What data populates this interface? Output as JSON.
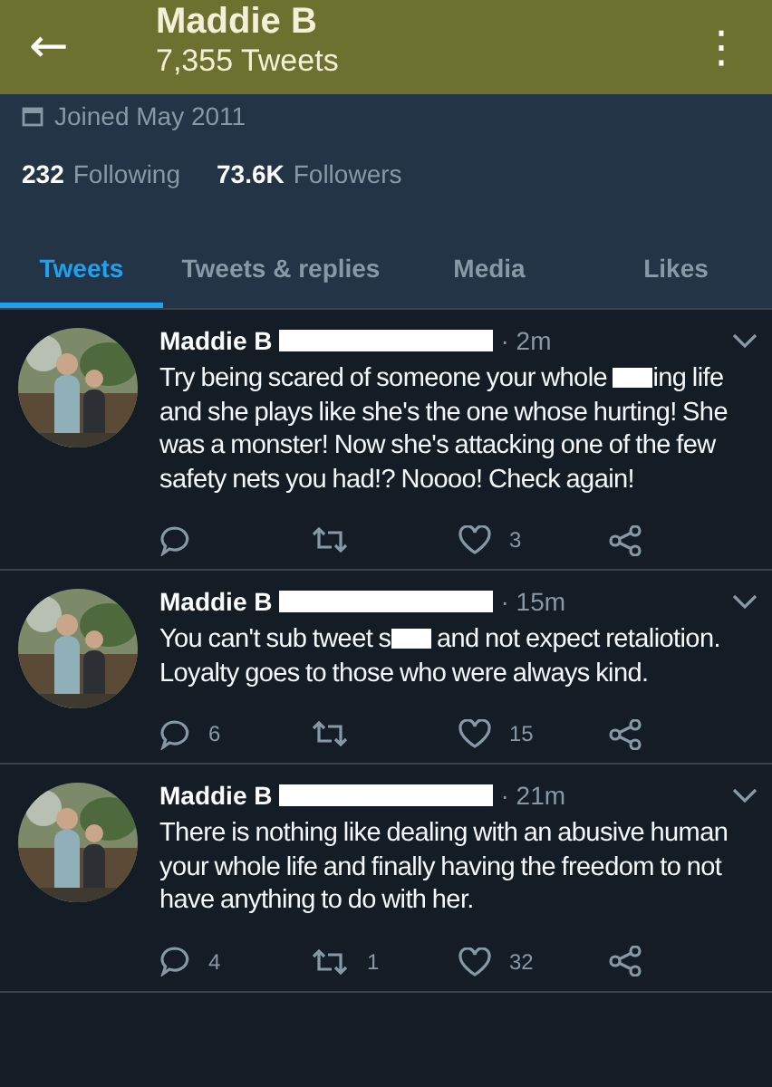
{
  "header": {
    "back_icon": "←",
    "title": "Maddie B",
    "subtitle": "7,355 Tweets",
    "menu_icon": "⋮"
  },
  "profile": {
    "joined": "Joined May 2011",
    "following_count": "232",
    "following_label": "Following",
    "followers_count": "73.6K",
    "followers_label": "Followers"
  },
  "tabs": [
    {
      "label": "Tweets",
      "selected": true
    },
    {
      "label": "Tweets & replies",
      "selected": false
    },
    {
      "label": "Media",
      "selected": false
    },
    {
      "label": "Likes",
      "selected": false
    }
  ],
  "tweets": [
    {
      "name": "Maddie B",
      "handle_hidden": true,
      "time": "· 2m",
      "body": [
        {
          "kind": "text",
          "text": "Try being scared of someone your whole "
        },
        {
          "kind": "redaction"
        },
        {
          "kind": "text",
          "text": "ing life and she plays like she's the one whose hurting! She was a monster! Now she's attacking one of the few safety nets you had!? Noooo! Check again!"
        }
      ],
      "likes": "3"
    },
    {
      "name": "Maddie B",
      "handle_hidden": true,
      "time": "· 15m",
      "body": [
        {
          "kind": "text",
          "text": "You can't sub tweet s"
        },
        {
          "kind": "redaction"
        },
        {
          "kind": "text",
          "text": " and not expect retaliotion. Loyalty goes to those who were always kind."
        }
      ],
      "replies": "6",
      "likes": "15"
    },
    {
      "name": "Maddie B",
      "handle_hidden": true,
      "time": "· 21m",
      "body": [
        {
          "kind": "text",
          "text": "There is nothing like dealing with an abusive human your whole life and finally having the freedom to not have anything to do with her."
        }
      ],
      "replies": "4",
      "retweets": "1",
      "likes": "32"
    }
  ]
}
